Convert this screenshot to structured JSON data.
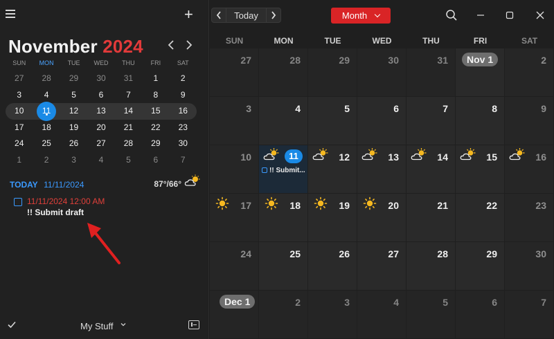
{
  "sidebar": {
    "mini_calendar": {
      "month": "November",
      "year": "2024",
      "dow": [
        "SUN",
        "MON",
        "TUE",
        "WED",
        "THU",
        "FRI",
        "SAT"
      ],
      "weeks": [
        [
          "27",
          "28",
          "29",
          "30",
          "31",
          "1",
          "2"
        ],
        [
          "3",
          "4",
          "5",
          "6",
          "7",
          "8",
          "9"
        ],
        [
          "10",
          "11",
          "12",
          "13",
          "14",
          "15",
          "16"
        ],
        [
          "17",
          "18",
          "19",
          "20",
          "21",
          "22",
          "23"
        ],
        [
          "24",
          "25",
          "26",
          "27",
          "28",
          "29",
          "30"
        ],
        [
          "1",
          "2",
          "3",
          "4",
          "5",
          "6",
          "7"
        ]
      ]
    },
    "today": {
      "label": "TODAY",
      "date": "11/11/2024",
      "temperature": "87°/66°",
      "weather_icon": "partly-sunny"
    },
    "event": {
      "time": "11/11/2024 12:00 AM",
      "title": "!! Submit draft"
    },
    "footer": {
      "calendar_set": "My Stuff"
    }
  },
  "toolbar": {
    "prev": "‹",
    "today": "Today",
    "next": "›",
    "view": "Month"
  },
  "month_view": {
    "dow": [
      "SUN",
      "MON",
      "TUE",
      "WED",
      "THU",
      "FRI",
      "SAT"
    ],
    "weeks": [
      [
        {
          "d": "27",
          "out": true
        },
        {
          "d": "28",
          "out": true
        },
        {
          "d": "29",
          "out": true
        },
        {
          "d": "30",
          "out": true
        },
        {
          "d": "31",
          "out": true
        },
        {
          "d": "Nov 1",
          "pill": true
        },
        {
          "d": "2"
        }
      ],
      [
        {
          "d": "3"
        },
        {
          "d": "4"
        },
        {
          "d": "5"
        },
        {
          "d": "6"
        },
        {
          "d": "7"
        },
        {
          "d": "8"
        },
        {
          "d": "9"
        }
      ],
      [
        {
          "d": "10"
        },
        {
          "d": "11",
          "today": true,
          "wx": "partly-sunny",
          "event": "!! Submit..."
        },
        {
          "d": "12",
          "wx": "partly-sunny"
        },
        {
          "d": "13",
          "wx": "partly-sunny"
        },
        {
          "d": "14",
          "wx": "partly-sunny"
        },
        {
          "d": "15",
          "wx": "partly-sunny"
        },
        {
          "d": "16",
          "wx": "partly-sunny"
        }
      ],
      [
        {
          "d": "17",
          "wx": "sunny"
        },
        {
          "d": "18",
          "wx": "sunny"
        },
        {
          "d": "19",
          "wx": "sunny"
        },
        {
          "d": "20",
          "wx": "sunny"
        },
        {
          "d": "21"
        },
        {
          "d": "22"
        },
        {
          "d": "23"
        }
      ],
      [
        {
          "d": "24"
        },
        {
          "d": "25"
        },
        {
          "d": "26"
        },
        {
          "d": "27"
        },
        {
          "d": "28"
        },
        {
          "d": "29"
        },
        {
          "d": "30"
        }
      ],
      [
        {
          "d": "Dec 1",
          "pill": true,
          "out": true
        },
        {
          "d": "2",
          "out": true
        },
        {
          "d": "3",
          "out": true
        },
        {
          "d": "4",
          "out": true
        },
        {
          "d": "5",
          "out": true
        },
        {
          "d": "6",
          "out": true
        },
        {
          "d": "7",
          "out": true
        }
      ]
    ]
  },
  "colors": {
    "accent_blue": "#1a8ae6",
    "accent_red": "#d92426",
    "year_red": "#e23a3a"
  }
}
